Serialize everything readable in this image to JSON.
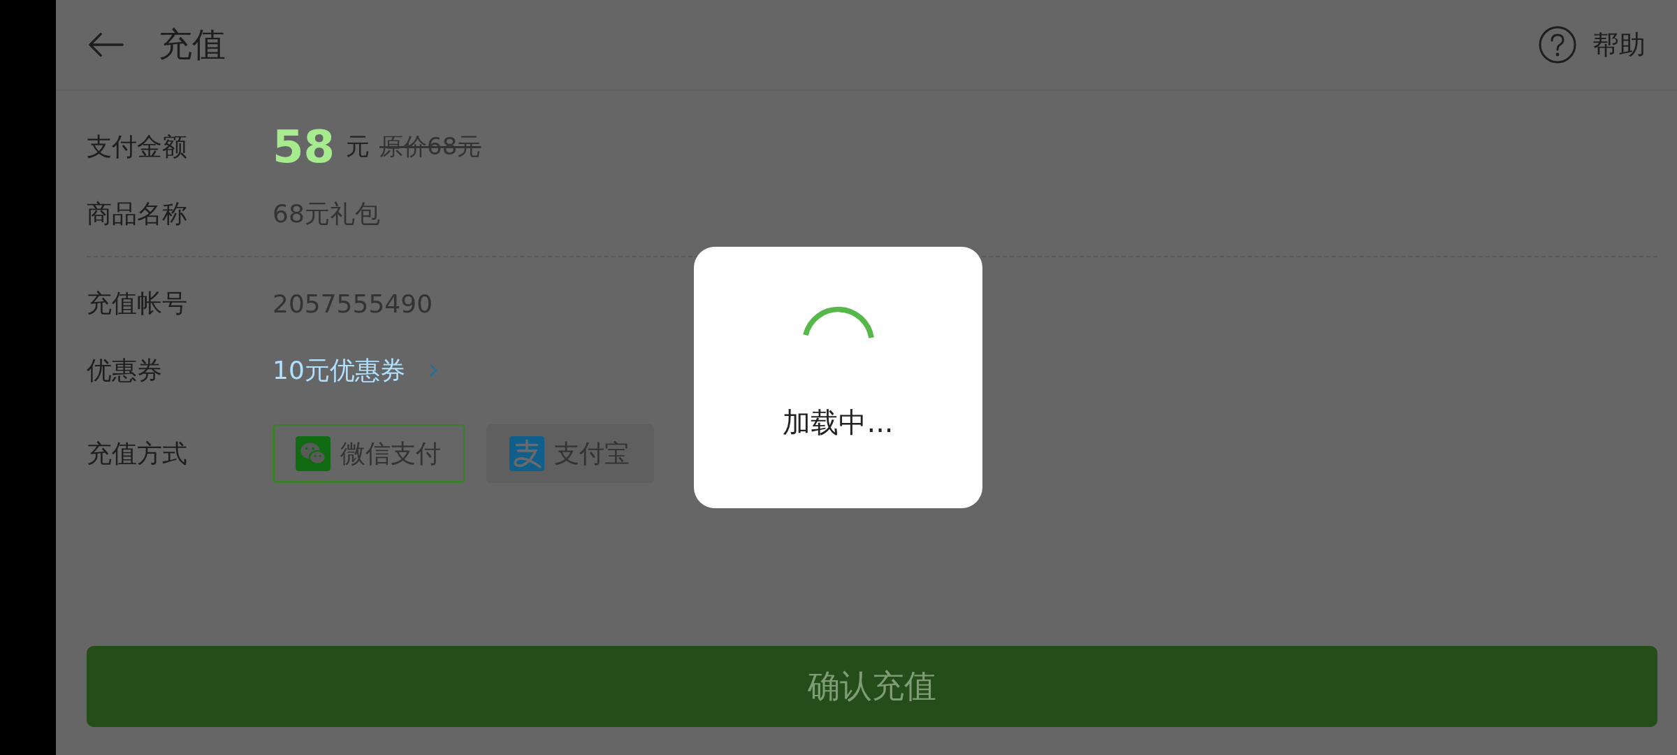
{
  "header": {
    "title": "充值",
    "help_label": "帮助"
  },
  "order_fields": [
    {
      "kind": "price",
      "label": "支付金额",
      "amount": "58",
      "unit": "元",
      "original_price": "原价68元"
    },
    {
      "kind": "text",
      "label": "商品名称",
      "value": "68元礼包"
    }
  ],
  "account_fields": [
    {
      "kind": "text",
      "label": "充值帐号",
      "value": "2057555490"
    },
    {
      "kind": "link",
      "label": "优惠券",
      "value": "10元优惠券"
    },
    {
      "kind": "methods",
      "label": "充值方式",
      "methods": [
        {
          "name": "微信支付",
          "kind": "wechat",
          "selected": true
        },
        {
          "name": "支付宝",
          "kind": "alipay",
          "selected": false
        }
      ]
    }
  ],
  "confirm_button": "确认充值",
  "loading": {
    "text": "加载中..."
  }
}
